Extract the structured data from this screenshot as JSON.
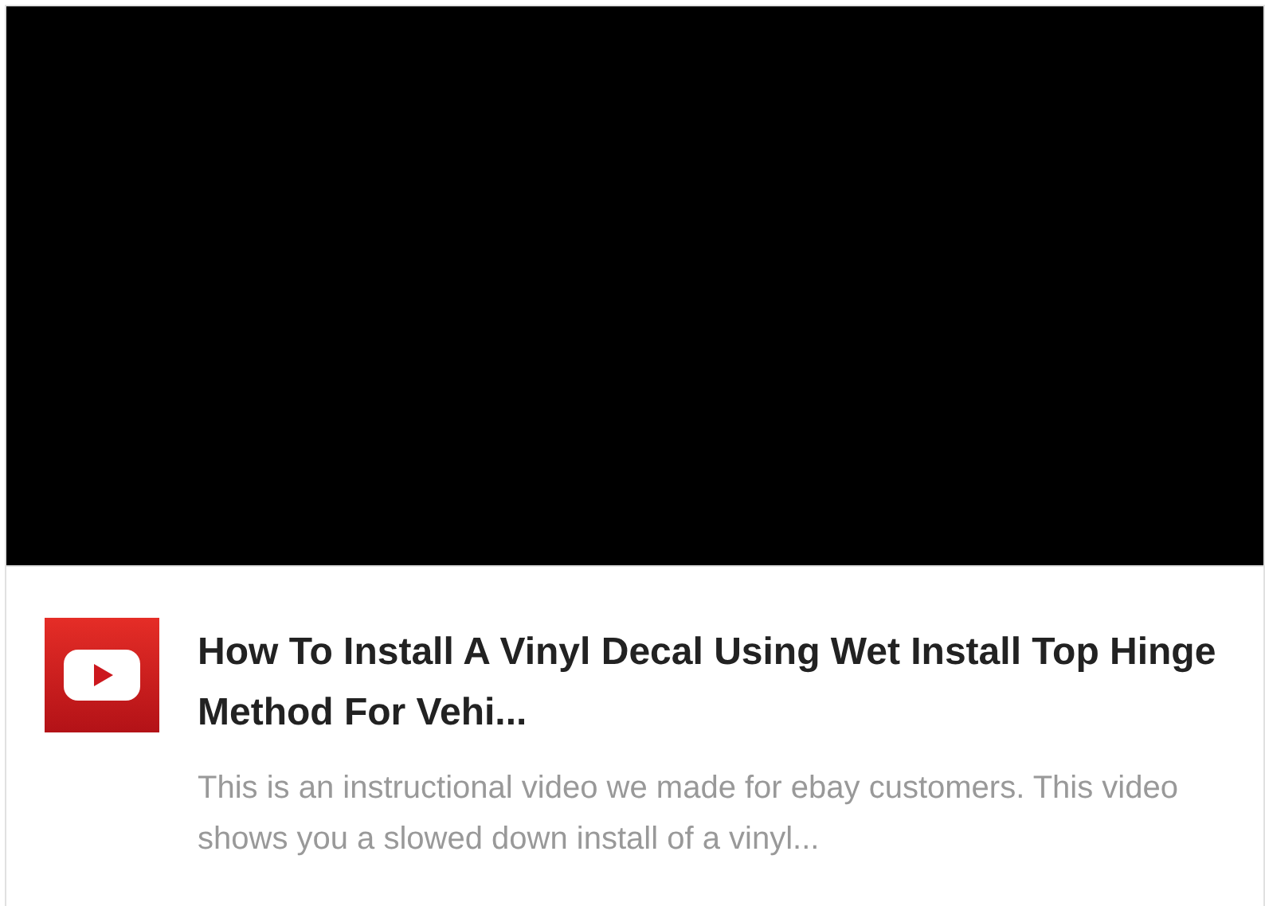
{
  "video": {
    "kind": "black"
  },
  "card": {
    "title": "How To Install A Vinyl Decal Using Wet Install Top Hinge Method For Vehi...",
    "description": "This is an instructional video we made for ebay customers. This video shows you a slowed down install of a vinyl..."
  }
}
